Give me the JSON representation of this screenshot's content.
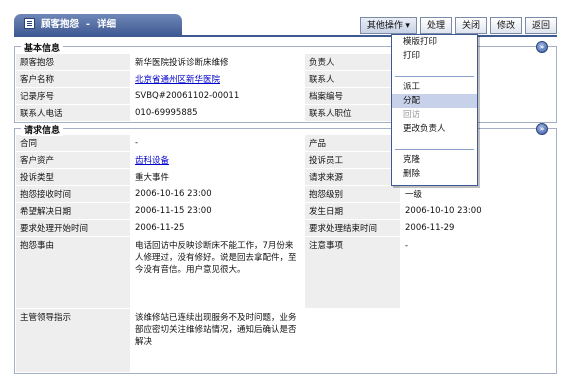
{
  "header": {
    "tab_title": "顾客抱怨",
    "separator": "-",
    "tab_subtitle": "详细"
  },
  "toolbar": {
    "other_ops": "其他操作 ▾",
    "process": "处理",
    "close": "关闭",
    "edit": "修改",
    "back": "返回"
  },
  "basic": {
    "title": "基本信息",
    "rows": [
      {
        "l1": "顾客抱怨",
        "v1": "新华医院投诉诊断床维修",
        "l2": "负责人",
        "v2": ""
      },
      {
        "l1": "客户名称",
        "v1": "北京省通州区新华医院",
        "l2": "联系人",
        "v2": ""
      },
      {
        "l1": "记录序号",
        "v1": "SVBQ#20061102-00011",
        "l2": "档案编号",
        "v2": ""
      },
      {
        "l1": "联系人电话",
        "v1": "010-69995885",
        "l2": "联系人职位",
        "v2": ""
      }
    ]
  },
  "request": {
    "title": "请求信息",
    "rows": [
      {
        "l1": "合同",
        "v1": "-",
        "l2": "产品",
        "v2": ""
      },
      {
        "l1": "客户资产",
        "v1": "齿科设备",
        "l2": "投诉员工",
        "v2": ""
      },
      {
        "l1": "投诉类型",
        "v1": "重大事件",
        "l2": "请求来源",
        "v2": ""
      },
      {
        "l1": "抱怨接收时间",
        "v1": "2006-10-16 23:00",
        "l2": "抱怨级别",
        "v2": "一级"
      },
      {
        "l1": "希望解决日期",
        "v1": "2006-11-15 23:00",
        "l2": "发生日期",
        "v2": "2006-10-10 23:00"
      },
      {
        "l1": "要求处理开始时间",
        "v1": "2006-11-25",
        "l2": "要求处理结束时间",
        "v2": "2006-11-29"
      }
    ],
    "reason_label": "抱怨事由",
    "reason_text": "电话回访中反映诊断床不能工作，7月份来人修理过，没有修好。说是回去拿配件，至今没有音信。用户意见很大。",
    "note_label": "注意事项",
    "note_value": "-",
    "instruction_label": "主管领导指示",
    "instruction_text": "该维修站已连续出现服务不及时问题，业务部应密切关注维修站情况，通知后确认是否解决"
  },
  "menu": {
    "items": [
      {
        "label": "模版打印",
        "state": "normal"
      },
      {
        "label": "打印",
        "state": "normal"
      },
      {
        "label": "派工",
        "state": "normal"
      },
      {
        "label": "分配",
        "state": "highlight"
      },
      {
        "label": "回访",
        "state": "disabled"
      },
      {
        "label": "更改负责人",
        "state": "normal"
      },
      {
        "label": "克隆",
        "state": "normal"
      },
      {
        "label": "删除",
        "state": "normal"
      }
    ]
  },
  "icons": {
    "collapse": "collapse-circle-icon",
    "tab": "document-icon"
  },
  "colors": {
    "accent": "#3f5a93",
    "label_bg": "#eeeeee",
    "link": "#0000cc",
    "highlight": "#c7d2ea"
  }
}
